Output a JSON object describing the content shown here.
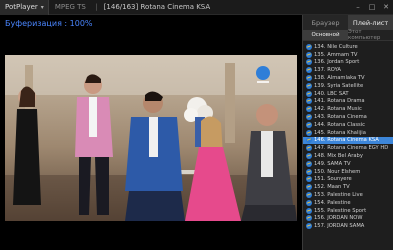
{
  "titlebar": {
    "app_name": "PotPlayer",
    "format": "MPEG TS",
    "track": "[146/163]",
    "channel": "Rotana Cinema KSA",
    "minimize": "–",
    "maximize": "□",
    "close": "✕"
  },
  "buffering_text": "Буферизация : 100%",
  "panel": {
    "tabs": [
      {
        "label": "Браузер",
        "active": false
      },
      {
        "label": "Плей-лист",
        "active": true
      }
    ],
    "subtabs": [
      {
        "label": "Основной",
        "active": true
      },
      {
        "label": "Этот компьютер",
        "active": false
      }
    ],
    "active_index": 12,
    "items": [
      "134. Nile Culture",
      "135. Ammam TV",
      "136. Jordan Sport",
      "137. ROYA",
      "138. Almamlaka TV",
      "139. Syria Satellite",
      "140. LBC SAT",
      "141. Rotana Drama",
      "142. Rotana Music",
      "143. Rotana Cinema",
      "144. Rotana Classic",
      "145. Rotana Khalijia",
      "146. Rotana Cinema KSA",
      "147. Rotana Cinema EGY HD",
      "148. Mix Bel Araby",
      "149. SAMA TV",
      "150. Nour Elshem",
      "151. Sounyere",
      "152. Maan TV",
      "153. Palestine Live",
      "154. Palestine",
      "155. Palestine Sport",
      "156. JORDAN NOW",
      "157. JORDAN SAMA"
    ]
  },
  "colors": {
    "accent": "#4a86ff",
    "selection": "#3d86d9"
  }
}
